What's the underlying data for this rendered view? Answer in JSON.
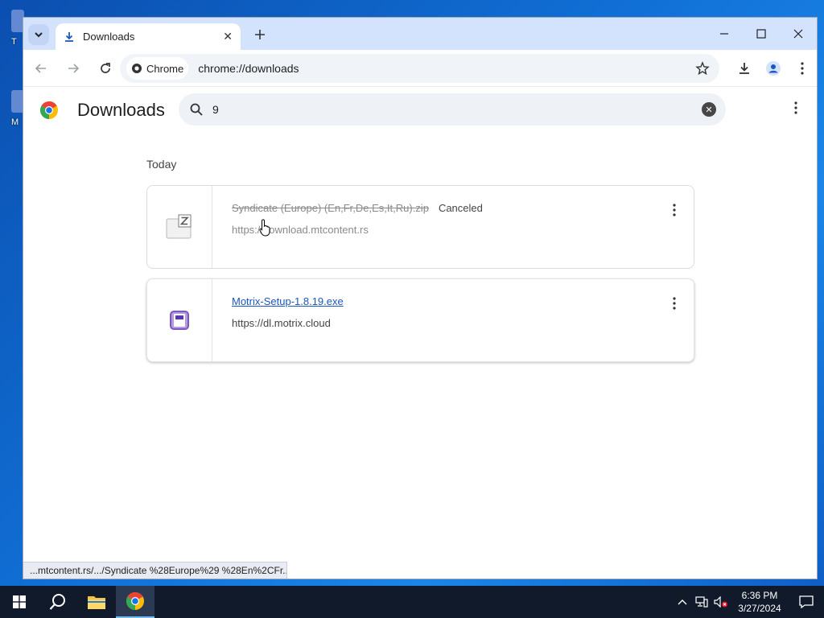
{
  "desktop": {
    "icon_a_label": "T",
    "icon_b_label": "M"
  },
  "browser": {
    "tab": {
      "title": "Downloads"
    },
    "omnibox": {
      "chip_label": "Chrome",
      "url": "chrome://downloads"
    }
  },
  "page": {
    "title": "Downloads",
    "search_value": "9",
    "section": "Today",
    "downloads": [
      {
        "filename": "Syndicate (Europe) (En,Fr,De,Es,It,Ru).zip",
        "status": "Canceled",
        "source": "https://download.mtcontent.rs"
      },
      {
        "filename": "Motrix-Setup-1.8.19.exe",
        "status": "",
        "source": "https://dl.motrix.cloud"
      }
    ]
  },
  "statusbar": {
    "text": "...mtcontent.rs/.../Syndicate %28Europe%29 %28En%2CFr..."
  },
  "taskbar": {
    "time": "6:36 PM",
    "date": "3/27/2024"
  },
  "colors": {
    "link": "#1a57c0",
    "tabstrip": "#d3e3fd",
    "taskbar": "#101a2a"
  }
}
